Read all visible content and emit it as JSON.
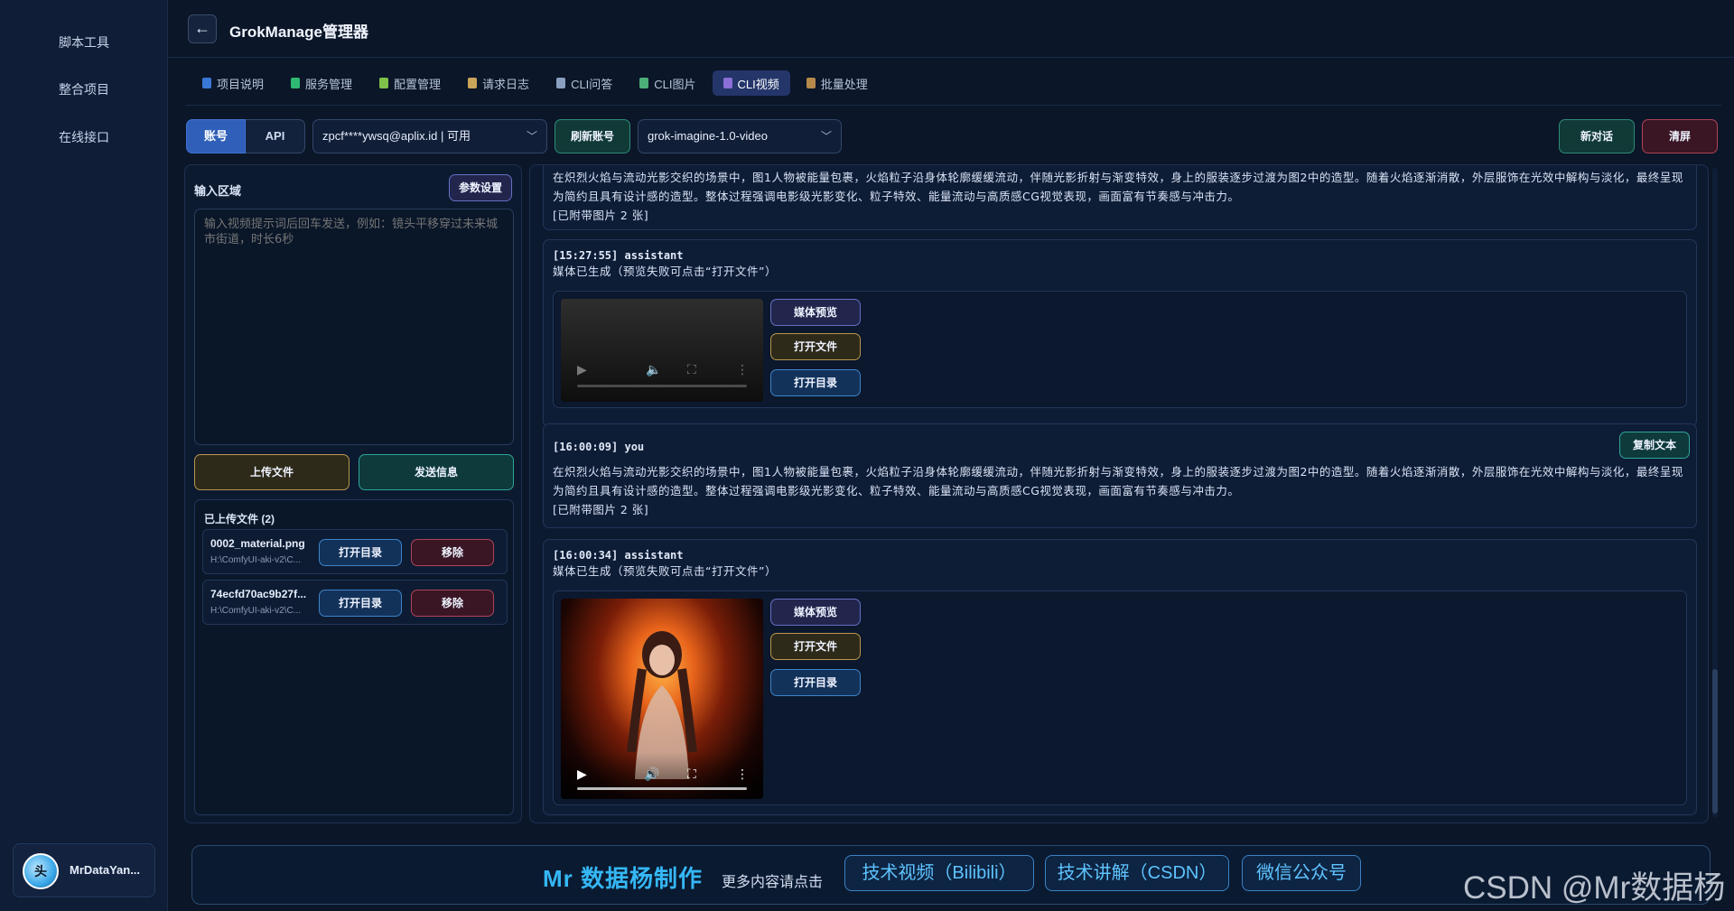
{
  "sidebar": {
    "items": [
      {
        "label": "脚本工具"
      },
      {
        "label": "整合项目"
      },
      {
        "label": "在线接口"
      }
    ],
    "user": {
      "avatar_text": "头",
      "name": "MrDataYan..."
    }
  },
  "header": {
    "back_glyph": "←",
    "title": "GrokManage管理器"
  },
  "tabs": [
    {
      "label": "项目说明",
      "color": "#3a78d8"
    },
    {
      "label": "服务管理",
      "color": "#2eb872"
    },
    {
      "label": "配置管理",
      "color": "#7ec24a"
    },
    {
      "label": "请求日志",
      "color": "#c9a55a"
    },
    {
      "label": "CLI问答",
      "color": "#8aa0c0"
    },
    {
      "label": "CLI图片",
      "color": "#4caf78"
    },
    {
      "label": "CLI视频",
      "color": "#8b6fd6",
      "active": true
    },
    {
      "label": "批量处理",
      "color": "#b5894a"
    }
  ],
  "toolbar": {
    "account_tab": "账号",
    "api_tab": "API",
    "account_select": "zpcf****ywsq@aplix.id | 可用",
    "refresh_button": "刷新账号",
    "model_select": "grok-imagine-1.0-video",
    "new_chat_button": "新对话",
    "clear_button": "清屏"
  },
  "left": {
    "input_heading": "输入区域",
    "params_button": "参数设置",
    "prompt_placeholder": "输入视频提示词后回车发送，例如：镜头平移穿过未来城市街道，时长6秒",
    "upload_button": "上传文件",
    "send_button": "发送信息",
    "uploaded_heading": "已上传文件 (2)",
    "files": [
      {
        "name": "0002_material.png",
        "path": "H:\\ComfyUI-aki-v2\\C...",
        "open_dir": "打开目录",
        "remove": "移除"
      },
      {
        "name": "74ecfd70ac9b27f...",
        "path": "H:\\ComfyUI-aki-v2\\C...",
        "open_dir": "打开目录",
        "remove": "移除"
      }
    ]
  },
  "chat": {
    "prompt_text": "在炽烈火焰与流动光影交织的场景中，图1人物被能量包裹，火焰粒子沿身体轮廓缓缓流动，伴随光影折射与渐变特效，身上的服装逐步过渡为图2中的造型。随着火焰逐渐消散，外层服饰在光效中解构与淡化，最终呈现为简约且具有设计感的造型。整体过程强调电影级光影变化、粒子特效、能量流动与高质感CG视觉表现，画面富有节奏感与冲击力。",
    "attached_note": "[已附带图片 2 张]",
    "media_label": "媒体已生成（预览失败可点击“打开文件”）",
    "preview_button": "媒体预览",
    "open_file_button": "打开文件",
    "open_dir_button": "打开目录",
    "copy_button": "复制文本",
    "messages": [
      {
        "header": "[15:27:55] assistant"
      },
      {
        "header": "[16:00:09] you"
      },
      {
        "header": "[16:00:34] assistant"
      }
    ]
  },
  "footer": {
    "brand": "Mr 数据杨制作",
    "more": "更多内容请点击",
    "links": [
      "技术视频（Bilibili）",
      "技术讲解（CSDN）",
      "微信公众号"
    ]
  },
  "watermark": "CSDN @Mr数据杨"
}
